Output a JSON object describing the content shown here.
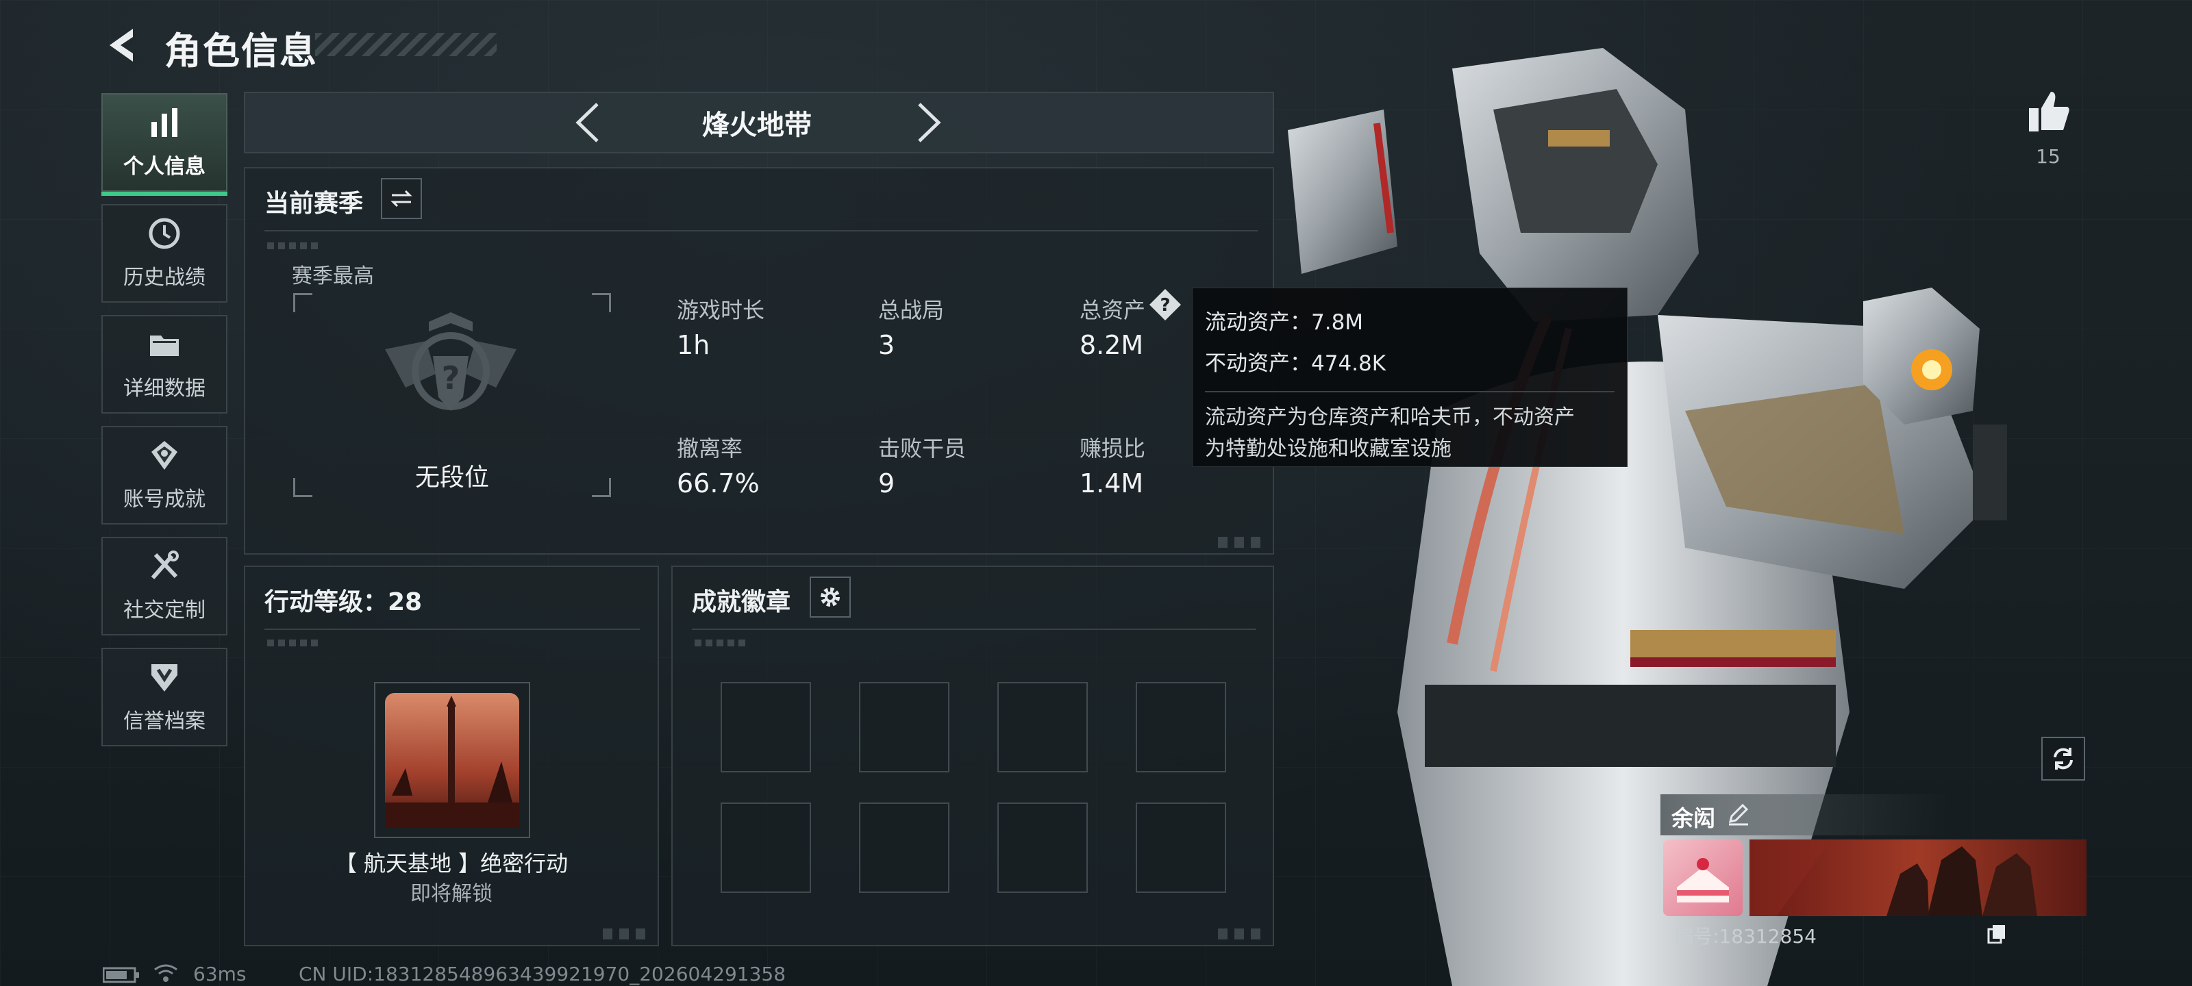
{
  "header": {
    "title": "角色信息"
  },
  "sidebar": {
    "items": [
      {
        "label": "个人信息",
        "icon": "bar-chart-icon",
        "active": true
      },
      {
        "label": "历史战绩",
        "icon": "history-clock-icon"
      },
      {
        "label": "详细数据",
        "icon": "folder-icon"
      },
      {
        "label": "账号成就",
        "icon": "achievement-icon"
      },
      {
        "label": "社交定制",
        "icon": "tools-icon"
      },
      {
        "label": "信誉档案",
        "icon": "credibility-icon"
      }
    ]
  },
  "mode": {
    "name": "烽火地带"
  },
  "season": {
    "title": "当前赛季",
    "best_label": "赛季最高",
    "rank_text": "无段位",
    "stats": [
      {
        "label": "游戏时长",
        "value": "1h"
      },
      {
        "label": "总战局",
        "value": "3"
      },
      {
        "label": "总资产",
        "value": "8.2M"
      },
      {
        "label": "撤离率",
        "value": "66.7%"
      },
      {
        "label": "击败干员",
        "value": "9"
      },
      {
        "label": "赚损比",
        "value": "1.4M"
      }
    ]
  },
  "tooltip": {
    "liquid": "流动资产：7.8M",
    "fixed": "不动资产：474.8K",
    "desc_line1": "流动资产为仓库资产和哈夫币，不动资产",
    "desc_line2": "为特勤处设施和收藏室设施"
  },
  "action": {
    "title": "行动等级：28",
    "op_name": "【 航天基地 】绝密行动",
    "op_status": "即将解锁"
  },
  "badges": {
    "title": "成就徽章",
    "slots": 8
  },
  "likes": {
    "count": "15"
  },
  "profile": {
    "name": "余闳",
    "id_text": "编号:18312854"
  },
  "status_bar": {
    "ping": "63ms",
    "uid": "CN UID:18312854896343992197​0_202604291358"
  },
  "colors": {
    "accent_green": "#3fc98a",
    "tooltip_bg": "#0a0c0e"
  }
}
